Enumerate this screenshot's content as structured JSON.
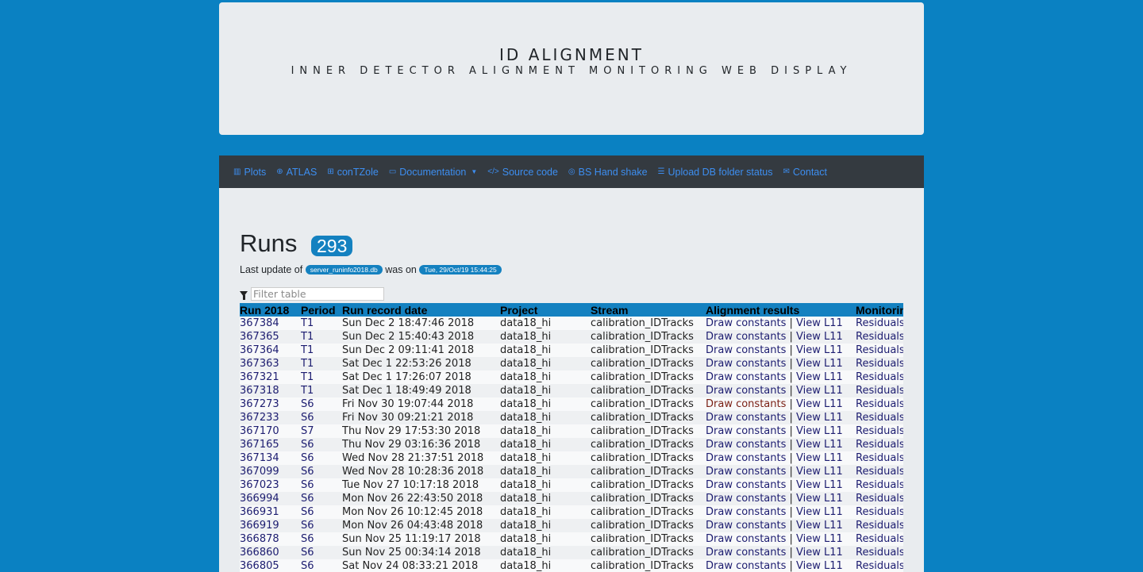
{
  "header": {
    "title": "ID ALIGNMENT",
    "subtitle": "INNER DETECTOR ALIGNMENT MONITORING WEB DISPLAY"
  },
  "nav": [
    {
      "icon": "chart-icon",
      "glyph": "▥",
      "label": "Plots"
    },
    {
      "icon": "globe-icon",
      "glyph": "⊕",
      "label": "ATLAS"
    },
    {
      "icon": "table-icon",
      "glyph": "⊞",
      "label": "conTZole"
    },
    {
      "icon": "folder-icon",
      "glyph": "▭",
      "label": "Documentation",
      "dropdown": true
    },
    {
      "icon": "code-icon",
      "glyph": "</>",
      "label": "Source code"
    },
    {
      "icon": "handshake-icon",
      "glyph": "◎",
      "label": "BS Hand shake"
    },
    {
      "icon": "list-icon",
      "glyph": "☰",
      "label": "Upload DB folder status"
    },
    {
      "icon": "envelope-icon",
      "glyph": "✉",
      "label": "Contact"
    }
  ],
  "runs": {
    "heading": "Runs",
    "count": "293",
    "last_update_prefix": "Last update of",
    "db_name": "server_runinfo2018.db",
    "was_on": "was on",
    "timestamp": "Tue, 29/Oct/19 15:44:25",
    "filter_placeholder": "Filter table"
  },
  "table": {
    "columns": [
      "Run 2018",
      "Period",
      "Run record date",
      "Project",
      "Stream",
      "Alignment results",
      "Monitoring"
    ],
    "rows": [
      {
        "run": "367384",
        "period": "T1",
        "date": "Sun Dec 2 18:47:46 2018",
        "project": "data18_hi",
        "stream": "calibration_IDTracks",
        "draw": "Draw constants",
        "draw_status": "ok",
        "sep": " | ",
        "view": "View L11",
        "mon": "Residuals"
      },
      {
        "run": "367365",
        "period": "T1",
        "date": "Sun Dec 2 15:40:43 2018",
        "project": "data18_hi",
        "stream": "calibration_IDTracks",
        "draw": "Draw constants",
        "draw_status": "ok",
        "sep": " | ",
        "view": "View L11",
        "mon": "Residuals"
      },
      {
        "run": "367364",
        "period": "T1",
        "date": "Sun Dec 2 09:11:41 2018",
        "project": "data18_hi",
        "stream": "calibration_IDTracks",
        "draw": "Draw constants",
        "draw_status": "ok",
        "sep": " | ",
        "view": "View L11",
        "mon": "Residuals"
      },
      {
        "run": "367363",
        "period": "T1",
        "date": "Sat Dec 1 22:53:26 2018",
        "project": "data18_hi",
        "stream": "calibration_IDTracks",
        "draw": "Draw constants",
        "draw_status": "ok",
        "sep": " | ",
        "view": "View L11",
        "mon": "Residuals"
      },
      {
        "run": "367321",
        "period": "T1",
        "date": "Sat Dec 1 17:26:07 2018",
        "project": "data18_hi",
        "stream": "calibration_IDTracks",
        "draw": "Draw constants",
        "draw_status": "ok",
        "sep": " | ",
        "view": "View L11",
        "mon": "Residuals"
      },
      {
        "run": "367318",
        "period": "T1",
        "date": "Sat Dec 1 18:49:49 2018",
        "project": "data18_hi",
        "stream": "calibration_IDTracks",
        "draw": "Draw constants",
        "draw_status": "ok",
        "sep": " | ",
        "view": "View L11",
        "mon": "Residuals"
      },
      {
        "run": "367273",
        "period": "S6",
        "date": "Fri Nov 30 19:07:44 2018",
        "project": "data18_hi",
        "stream": "calibration_IDTracks",
        "draw": "Draw constants",
        "draw_status": "warn",
        "sep": " | ",
        "view": "View L11",
        "mon": "Residuals"
      },
      {
        "run": "367233",
        "period": "S6",
        "date": "Fri Nov 30 09:21:21 2018",
        "project": "data18_hi",
        "stream": "calibration_IDTracks",
        "draw": "Draw constants",
        "draw_status": "ok",
        "sep": " | ",
        "view": "View L11",
        "mon": "Residuals"
      },
      {
        "run": "367170",
        "period": "S7",
        "date": "Thu Nov 29 17:53:30 2018",
        "project": "data18_hi",
        "stream": "calibration_IDTracks",
        "draw": "Draw constants",
        "draw_status": "ok",
        "sep": " | ",
        "view": "View L11",
        "mon": "Residuals"
      },
      {
        "run": "367165",
        "period": "S6",
        "date": "Thu Nov 29 03:16:36 2018",
        "project": "data18_hi",
        "stream": "calibration_IDTracks",
        "draw": "Draw constants",
        "draw_status": "ok",
        "sep": " | ",
        "view": "View L11",
        "mon": "Residuals"
      },
      {
        "run": "367134",
        "period": "S6",
        "date": "Wed Nov 28 21:37:51 2018",
        "project": "data18_hi",
        "stream": "calibration_IDTracks",
        "draw": "Draw constants",
        "draw_status": "ok",
        "sep": " | ",
        "view": "View L11",
        "mon": "Residuals"
      },
      {
        "run": "367099",
        "period": "S6",
        "date": "Wed Nov 28 10:28:36 2018",
        "project": "data18_hi",
        "stream": "calibration_IDTracks",
        "draw": "Draw constants",
        "draw_status": "ok",
        "sep": " | ",
        "view": "View L11",
        "mon": "Residuals"
      },
      {
        "run": "367023",
        "period": "S6",
        "date": "Tue Nov 27 10:17:18 2018",
        "project": "data18_hi",
        "stream": "calibration_IDTracks",
        "draw": "Draw constants",
        "draw_status": "ok",
        "sep": " | ",
        "view": "View L11",
        "mon": "Residuals"
      },
      {
        "run": "366994",
        "period": "S6",
        "date": "Mon Nov 26 22:43:50 2018",
        "project": "data18_hi",
        "stream": "calibration_IDTracks",
        "draw": "Draw constants",
        "draw_status": "ok",
        "sep": " | ",
        "view": "View L11",
        "mon": "Residuals"
      },
      {
        "run": "366931",
        "period": "S6",
        "date": "Mon Nov 26 10:12:45 2018",
        "project": "data18_hi",
        "stream": "calibration_IDTracks",
        "draw": "Draw constants",
        "draw_status": "ok",
        "sep": " | ",
        "view": "View L11",
        "mon": "Residuals"
      },
      {
        "run": "366919",
        "period": "S6",
        "date": "Mon Nov 26 04:43:48 2018",
        "project": "data18_hi",
        "stream": "calibration_IDTracks",
        "draw": "Draw constants",
        "draw_status": "ok",
        "sep": " | ",
        "view": "View L11",
        "mon": "Residuals"
      },
      {
        "run": "366878",
        "period": "S6",
        "date": "Sun Nov 25 11:19:17 2018",
        "project": "data18_hi",
        "stream": "calibration_IDTracks",
        "draw": "Draw constants",
        "draw_status": "ok",
        "sep": " | ",
        "view": "View L11",
        "mon": "Residuals"
      },
      {
        "run": "366860",
        "period": "S6",
        "date": "Sun Nov 25 00:34:14 2018",
        "project": "data18_hi",
        "stream": "calibration_IDTracks",
        "draw": "Draw constants",
        "draw_status": "ok",
        "sep": " | ",
        "view": "View L11",
        "mon": "Residuals"
      },
      {
        "run": "366805",
        "period": "S6",
        "date": "Sat Nov 24 08:33:21 2018",
        "project": "data18_hi",
        "stream": "calibration_IDTracks",
        "draw": "Draw constants",
        "draw_status": "ok",
        "sep": " | ",
        "view": "View L11",
        "mon": "Residuals"
      }
    ]
  },
  "colors": {
    "page_bg": "#0a81c2",
    "panel_bg": "#e9ecef",
    "navbar_bg": "#343a40",
    "nav_link": "#3d8ef0",
    "badge": "#1481c0",
    "link": "#1c1c70",
    "warn_link": "#7a1f14"
  }
}
